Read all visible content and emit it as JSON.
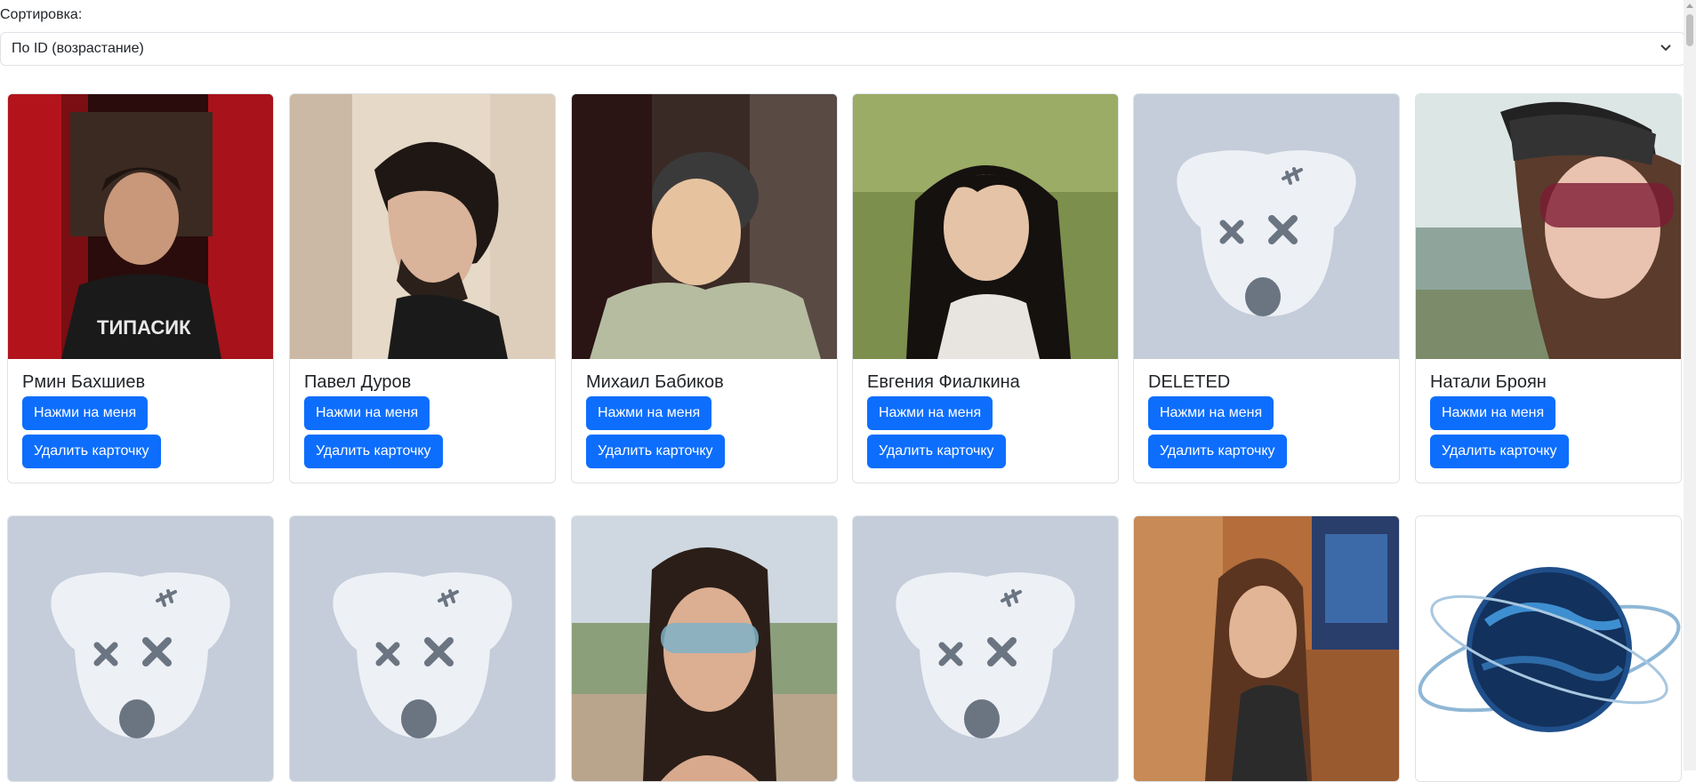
{
  "sort": {
    "label": "Сортировка:",
    "selected": "По ID (возрастание)"
  },
  "buttons": {
    "click_label": "Нажми на меня",
    "delete_label": "Удалить карточку"
  },
  "cards": [
    {
      "name": "Рмин Бахшиев",
      "photo": "photo-man-red-curtains"
    },
    {
      "name": "Павел Дуров",
      "photo": "photo-man-dark-hair-profile"
    },
    {
      "name": "Михаил Бабиков",
      "photo": "photo-man-beanie-hoodie"
    },
    {
      "name": "Евгения Фиалкина",
      "photo": "photo-woman-dark-hair-grass"
    },
    {
      "name": "DELETED",
      "photo": "deleted-dog-icon"
    },
    {
      "name": "Натали Броян",
      "photo": "photo-woman-cap-sunglasses"
    },
    {
      "name": "",
      "photo": "deleted-dog-icon"
    },
    {
      "name": "",
      "photo": "deleted-dog-icon"
    },
    {
      "name": "",
      "photo": "photo-woman-sunglasses-street"
    },
    {
      "name": "",
      "photo": "deleted-dog-icon"
    },
    {
      "name": "",
      "photo": "photo-woman-long-hair-brick-wall"
    },
    {
      "name": "",
      "photo": "photo-globe-logo"
    }
  ],
  "colors": {
    "primary": "#0d6efd",
    "deleted_bg": "#c4cdd9",
    "deleted_face": "#edf0f5",
    "deleted_marks": "#6b7582"
  }
}
